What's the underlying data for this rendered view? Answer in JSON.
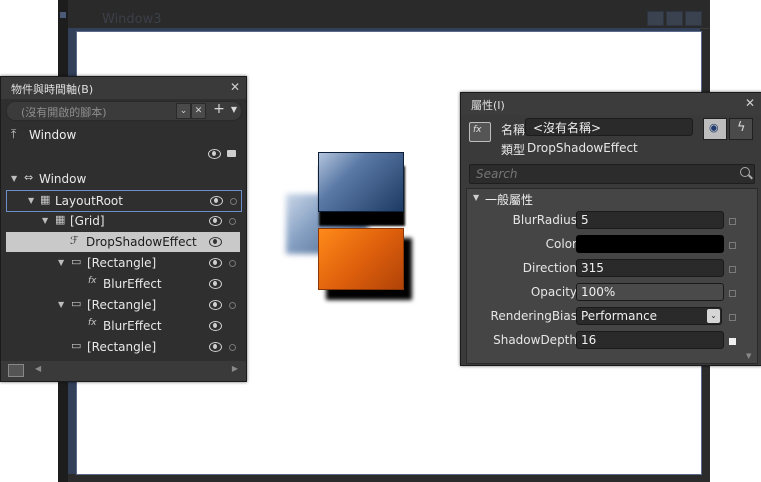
{
  "window3": {
    "title": "Window3"
  },
  "objects_panel": {
    "title": "物件與時間軸(B)",
    "storyboard_placeholder": "(沒有開啟的腳本)",
    "add_symbol": "+",
    "scope_label": "Window",
    "tree": [
      {
        "label": "Window",
        "expanded": true,
        "level": 0,
        "icon": "window-icon"
      },
      {
        "label": "LayoutRoot",
        "expanded": true,
        "level": 1,
        "icon": "grid-icon",
        "selected_outline": true
      },
      {
        "label": "[Grid]",
        "expanded": true,
        "level": 2,
        "icon": "grid-icon"
      },
      {
        "label": "DropShadowEffect",
        "expanded": false,
        "level": 3,
        "icon": "effect-icon",
        "selected": true
      },
      {
        "label": "[Rectangle]",
        "expanded": true,
        "level": 2,
        "icon": "rectangle-icon"
      },
      {
        "label": "BlurEffect",
        "expanded": false,
        "level": 3,
        "icon": "fx-icon"
      },
      {
        "label": "[Rectangle]",
        "expanded": true,
        "level": 2,
        "icon": "rectangle-icon"
      },
      {
        "label": "BlurEffect",
        "expanded": false,
        "level": 3,
        "icon": "fx-icon"
      },
      {
        "label": "[Rectangle]",
        "expanded": false,
        "level": 2,
        "icon": "rectangle-icon"
      }
    ]
  },
  "properties_panel": {
    "title": "屬性(I)",
    "name_label": "名稱",
    "name_value": "<沒有名稱>",
    "type_label": "類型",
    "type_value": "DropShadowEffect",
    "search_placeholder": "Search",
    "category": "一般屬性",
    "properties": [
      {
        "name": "BlurRadius",
        "value": "5"
      },
      {
        "name": "Color",
        "value": ""
      },
      {
        "name": "Direction",
        "value": "315"
      },
      {
        "name": "Opacity",
        "value": "100%"
      },
      {
        "name": "RenderingBias",
        "value": "Performance"
      },
      {
        "name": "ShadowDepth",
        "value": "16"
      }
    ]
  },
  "colors": {
    "panel_bg": "#3a3a3a",
    "selection_bg": "#c9c9c9",
    "shadow_color": "#000000",
    "orange": "#e0610c",
    "blue": "#1d3a63"
  }
}
